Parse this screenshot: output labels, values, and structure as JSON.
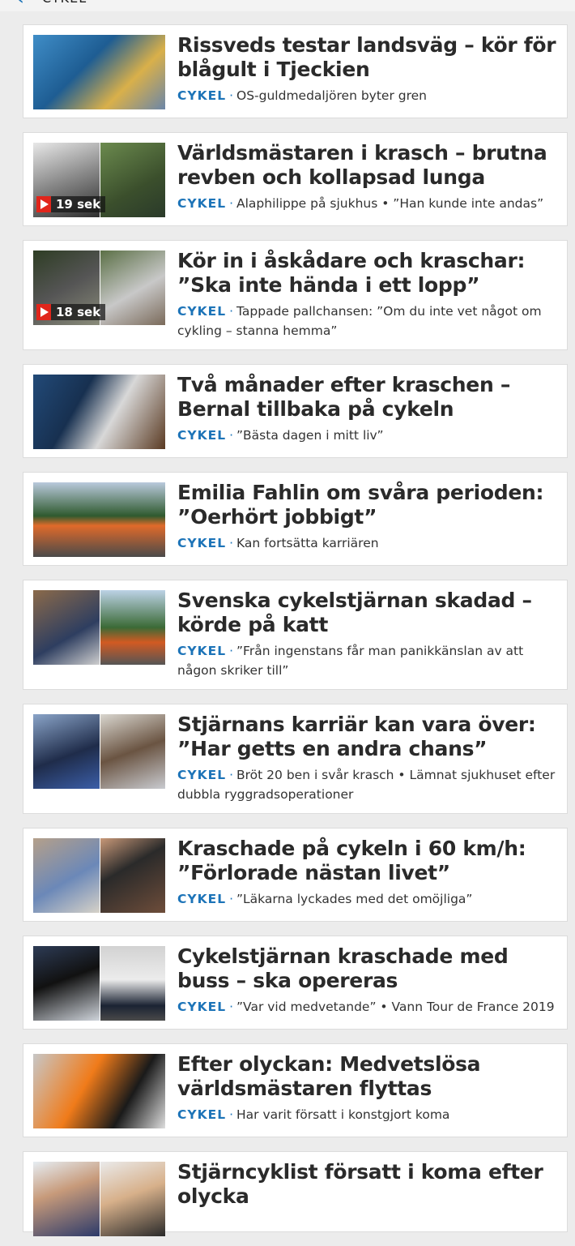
{
  "header": {
    "breadcrumb": "CYKEL"
  },
  "colors": {
    "accent": "#1d74b8",
    "video_badge": "#e1251b"
  },
  "articles": [
    {
      "headline": "Rissveds testar landsväg – kör för blågult i Tjeckien",
      "section": "CYKEL",
      "subtitle": "OS-guldmedaljören byter gren"
    },
    {
      "headline": "Världsmästaren i krasch – brutna revben och kollapsad lunga",
      "section": "CYKEL",
      "subtitle": "Alaphilippe på sjukhus • ”Han kunde inte andas”",
      "video": "19 sek"
    },
    {
      "headline": "Kör in i åskådare och kraschar: ”Ska inte hända i ett lopp”",
      "section": "CYKEL",
      "subtitle": "Tappade pallchansen: ”Om du inte vet något om cykling – stanna hemma”",
      "video": "18 sek"
    },
    {
      "headline": "Två månader efter kraschen – Bernal tillbaka på cykeln",
      "section": "CYKEL",
      "subtitle": "”Bästa dagen i mitt liv”"
    },
    {
      "headline": "Emilia Fahlin om svåra perioden: ”Oerhört jobbigt”",
      "section": "CYKEL",
      "subtitle": "Kan fortsätta karriären"
    },
    {
      "headline": "Svenska cykelstjärnan skadad – körde på katt",
      "section": "CYKEL",
      "subtitle": "”Från ingenstans får man panikkänslan av att någon skriker till”"
    },
    {
      "headline": "Stjärnans karriär kan vara över: ”Har getts en andra chans”",
      "section": "CYKEL",
      "subtitle": "Bröt 20 ben i svår krasch • Lämnat sjukhuset efter dubbla ryggradsoperationer"
    },
    {
      "headline": "Kraschade på cykeln i 60 km/h: ”Förlorade nästan livet”",
      "section": "CYKEL",
      "subtitle": "”Läkarna lyckades med det omöjliga”"
    },
    {
      "headline": "Cykelstjärnan kraschade med buss – ska opereras",
      "section": "CYKEL",
      "subtitle": "”Var vid medvetande” • Vann Tour de France 2019"
    },
    {
      "headline": "Efter olyckan: Medvetslösa världsmästaren flyttas",
      "section": "CYKEL",
      "subtitle": "Har varit försatt i konstgjort koma"
    },
    {
      "headline": "Stjärncyklist försatt i koma efter olycka",
      "section": "CYKEL",
      "subtitle": ""
    }
  ]
}
